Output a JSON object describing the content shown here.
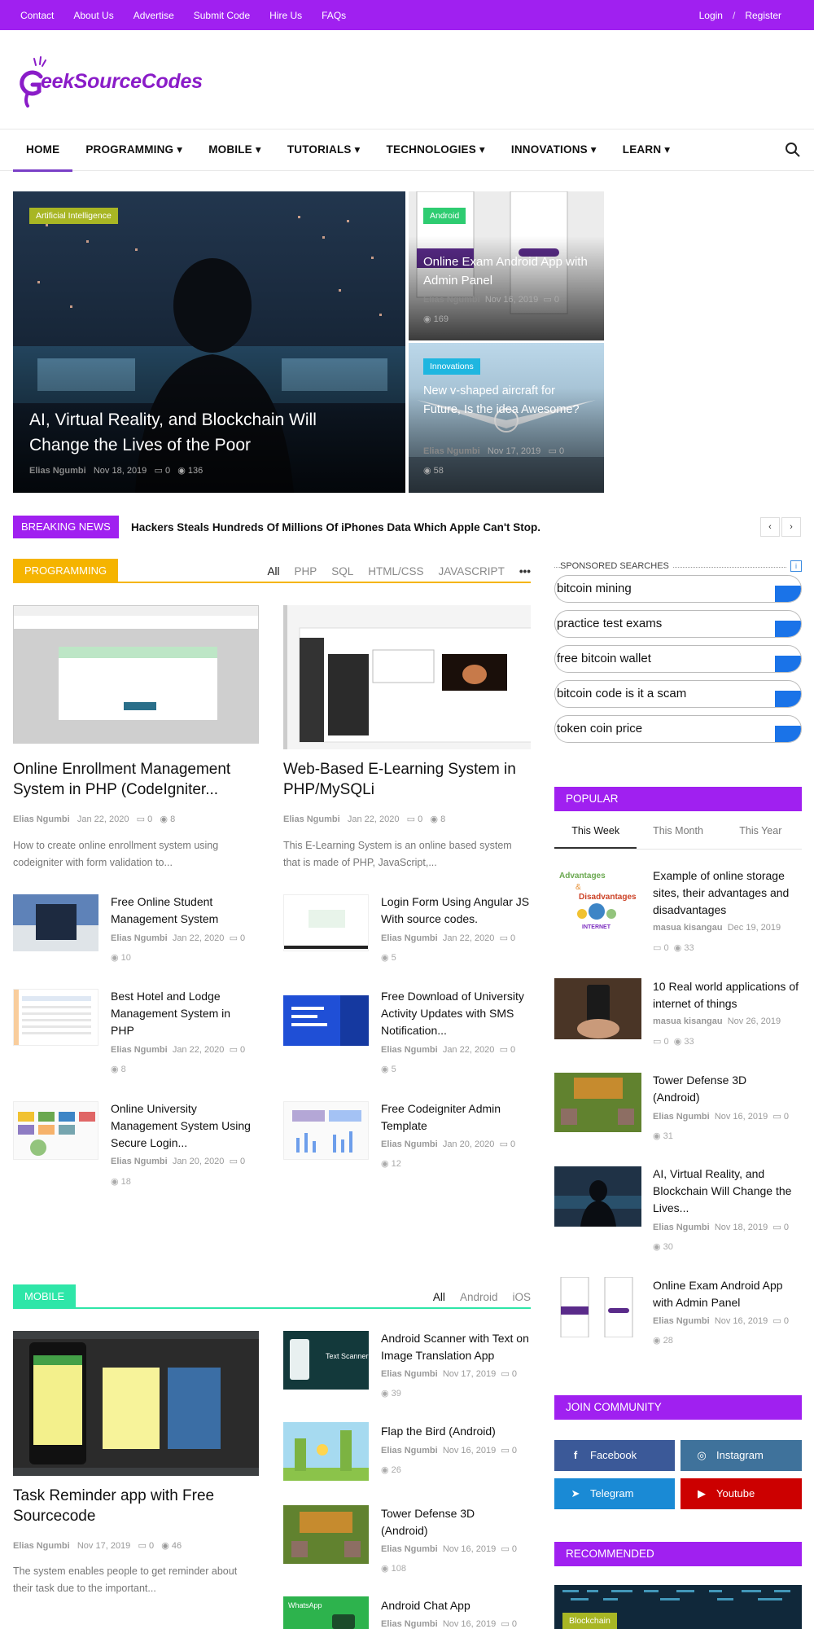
{
  "topbar": {
    "links": [
      "Contact",
      "About Us",
      "Advertise",
      "Submit Code",
      "Hire Us",
      "FAQs"
    ],
    "login": "Login",
    "sep": "/",
    "register": "Register"
  },
  "logo": {
    "text": "eekSourceCodes",
    "initial": "G"
  },
  "nav": {
    "items": [
      "HOME",
      "PROGRAMMING ▾",
      "MOBILE ▾",
      "TUTORIALS ▾",
      "TECHNOLOGIES ▾",
      "INNOVATIONS ▾",
      "LEARN ▾"
    ]
  },
  "hero": {
    "big": {
      "category": "Artificial Intelligence",
      "title": "AI, Virtual Reality, and Blockchain Will Change the Lives of the Poor",
      "author": "Elias Ngumbi",
      "date": "Nov 18, 2019",
      "comments": "0",
      "views": "136"
    },
    "sm1": {
      "category": "Android",
      "title": "Online Exam Android App with Admin Panel",
      "author": "Elias Ngumbi",
      "date": "Nov 16, 2019",
      "comments": "0",
      "views": "169"
    },
    "sm2": {
      "category": "Innovations",
      "title": "New v-shaped aircraft for Future, Is the idea Awesome?",
      "author": "Elias Ngumbi",
      "date": "Nov 17, 2019",
      "comments": "0",
      "views": "58"
    }
  },
  "breaking": {
    "label": "BREAKING NEWS",
    "text": "Hackers Steals Hundreds Of Millions Of iPhones Data Which Apple Can't Stop."
  },
  "programming": {
    "label": "PROGRAMMING",
    "tabs": [
      "All",
      "PHP",
      "SQL",
      "HTML/CSS",
      "JAVASCRIPT",
      "•••"
    ],
    "featured": [
      {
        "title": "Online Enrollment Management System in PHP (CodeIgniter...",
        "author": "Elias Ngumbi",
        "date": "Jan 22, 2020",
        "comments": "0",
        "views": "8",
        "excerpt": "How to create online enrollment system using codeigniter with form validation to..."
      },
      {
        "title": "Web-Based E-Learning System in PHP/MySQLi",
        "author": "Elias Ngumbi",
        "date": "Jan 22, 2020",
        "comments": "0",
        "views": "8",
        "excerpt": "This E-Learning System is an online based system that is made of PHP, JavaScript,..."
      }
    ],
    "small": [
      {
        "title": "Free Online Student Management System",
        "author": "Elias Ngumbi",
        "date": "Jan 22, 2020",
        "comments": "0",
        "views": "10"
      },
      {
        "title": "Login Form Using Angular JS With source codes.",
        "author": "Elias Ngumbi",
        "date": "Jan 22, 2020",
        "comments": "0",
        "views": "5"
      },
      {
        "title": "Best Hotel and Lodge Management System in PHP",
        "author": "Elias Ngumbi",
        "date": "Jan 22, 2020",
        "comments": "0",
        "views": "8"
      },
      {
        "title": "Free Download of University Activity Updates with SMS Notification...",
        "author": "Elias Ngumbi",
        "date": "Jan 22, 2020",
        "comments": "0",
        "views": "5"
      },
      {
        "title": "Online University Management System Using Secure Login...",
        "author": "Elias Ngumbi",
        "date": "Jan 20, 2020",
        "comments": "0",
        "views": "18"
      },
      {
        "title": "Free Codeigniter Admin Template",
        "author": "Elias Ngumbi",
        "date": "Jan 20, 2020",
        "comments": "0",
        "views": "12"
      }
    ]
  },
  "mobile": {
    "label": "MOBILE",
    "tabs": [
      "All",
      "Android",
      "iOS"
    ],
    "featured": {
      "title": "Task Reminder app with Free Sourcecode",
      "author": "Elias Ngumbi",
      "date": "Nov 17, 2019",
      "comments": "0",
      "views": "46",
      "excerpt": "The system enables people to get reminder about their task due to the important..."
    },
    "small": [
      {
        "title": "Android Scanner with Text on Image Translation App",
        "author": "Elias Ngumbi",
        "date": "Nov 17, 2019",
        "comments": "0",
        "views": "39",
        "thumb_text": "Text Scanner"
      },
      {
        "title": "Flap the Bird (Android)",
        "author": "Elias Ngumbi",
        "date": "Nov 16, 2019",
        "comments": "0",
        "views": "26"
      },
      {
        "title": "Tower Defense 3D (Android)",
        "author": "Elias Ngumbi",
        "date": "Nov 16, 2019",
        "comments": "0",
        "views": "108"
      },
      {
        "title": "Android Chat App",
        "author": "Elias Ngumbi",
        "date": "Nov 16, 2019",
        "comments": "0",
        "views": "",
        "thumb_text": "WhatsApp"
      }
    ]
  },
  "sponsored": {
    "label": "SPONSORED SEARCHES",
    "items": [
      "bitcoin mining",
      "practice test exams",
      "free bitcoin wallet",
      "bitcoin code is it a scam",
      "token coin price"
    ]
  },
  "popular": {
    "label": "POPULAR",
    "tabs": [
      "This Week",
      "This Month",
      "This Year"
    ],
    "items": [
      {
        "title": "Example of online storage sites, their advantages and disadvantages",
        "author": "masua kisangau",
        "date": "Dec 19, 2019",
        "comments": "0",
        "views": "33"
      },
      {
        "title": "10 Real world applications of internet of things",
        "author": "masua kisangau",
        "date": "Nov 26, 2019",
        "comments": "0",
        "views": "33"
      },
      {
        "title": "Tower Defense 3D (Android)",
        "author": "Elias Ngumbi",
        "date": "Nov 16, 2019",
        "comments": "0",
        "views": "31"
      },
      {
        "title": "AI, Virtual Reality, and Blockchain Will Change the Lives...",
        "author": "Elias Ngumbi",
        "date": "Nov 18, 2019",
        "comments": "0",
        "views": "30"
      },
      {
        "title": "Online Exam Android App with Admin Panel",
        "author": "Elias Ngumbi",
        "date": "Nov 16, 2019",
        "comments": "0",
        "views": "28"
      }
    ],
    "thumb1_lines": [
      "Advantages",
      "&",
      "Disadvantages",
      "INTERNET"
    ]
  },
  "community": {
    "label": "JOIN COMMUNITY",
    "buttons": [
      {
        "label": "Facebook",
        "icon": "f",
        "color": "#3b5998"
      },
      {
        "label": "Instagram",
        "icon": "◎",
        "color": "#3f729b"
      },
      {
        "label": "Telegram",
        "icon": "➤",
        "color": "#1a8ad5"
      },
      {
        "label": "Youtube",
        "icon": "▶",
        "color": "#cc0000"
      }
    ]
  },
  "recommended": {
    "label": "RECOMMENDED",
    "category": "Blockchain"
  },
  "colors": {
    "accent": "#a020f0",
    "programming": "#f5b400",
    "mobile": "#2ee6a8",
    "android": "#2ecc71",
    "innovations": "#1fb6e0",
    "ai": "#a8b624",
    "blue": "#1a73e8"
  }
}
